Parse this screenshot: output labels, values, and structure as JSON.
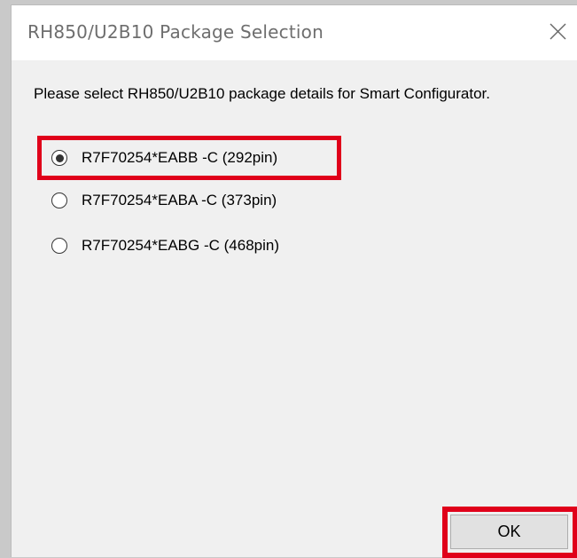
{
  "window": {
    "title": "RH850/U2B10 Package Selection"
  },
  "prompt": "Please select RH850/U2B10 package details for Smart Configurator.",
  "options": [
    {
      "label": "R7F70254*EABB -C (292pin)",
      "selected": true
    },
    {
      "label": "R7F70254*EABA -C (373pin)",
      "selected": false
    },
    {
      "label": "R7F70254*EABG -C (468pin)",
      "selected": false
    }
  ],
  "buttons": {
    "ok_label": "OK"
  },
  "colors": {
    "highlight": "#e0001a",
    "dialog_bg": "#f0f0f0",
    "titlebar_bg": "#ffffff",
    "title_text": "#6e6e6e"
  },
  "icons": {
    "close": "close-icon"
  }
}
